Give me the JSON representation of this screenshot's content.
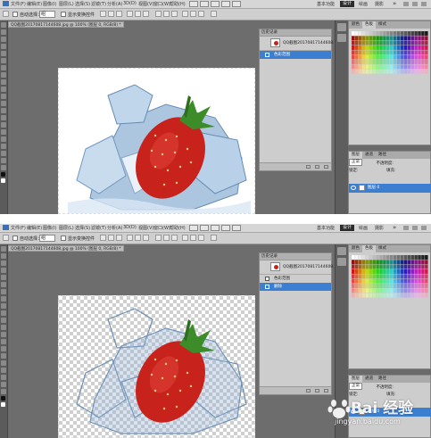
{
  "menu": {
    "items": [
      "文件(F)",
      "编辑(E)",
      "图像(I)",
      "图层(L)",
      "选择(S)",
      "滤镜(T)",
      "分析(A)",
      "3D(D)",
      "视图(V)",
      "窗口(W)",
      "帮助(H)"
    ],
    "workspaces": [
      "基本功能",
      "设计",
      "绘画",
      "摄影"
    ]
  },
  "options": {
    "auto_select": "自动选择：",
    "auto_select_target": "组",
    "transform_controls": "显示变换控件"
  },
  "document": {
    "tab1": "QQ截图20170817144608.jpg @ 100% (图层 0, RGB/8) *",
    "tab2": "QQ截图20170817144608.jpg @ 100% (图层 0, RGB/8) *"
  },
  "history": {
    "title": "历史记录",
    "snapshot": "QQ截图20170817144608...",
    "shot1_states": [
      "色彩范围"
    ],
    "shot2_states": [
      "色彩范围",
      "删除"
    ]
  },
  "panels": {
    "swatch_tabs": [
      "颜色",
      "色板",
      "样式"
    ],
    "layer_tabs": [
      "图层",
      "通道",
      "路径"
    ],
    "blend_mode": "正常",
    "opacity_label": "不透明度:",
    "lock_label": "锁定:",
    "fill_label": "填充:",
    "layer_name": "图层 0"
  },
  "watermark": {
    "brand": "Bai 经验",
    "url": "jingyan.baidu.com"
  },
  "colors": {
    "active_highlight": "#3c7fd0",
    "strawberry": "#c8221d",
    "leaf": "#3d8c2a",
    "ice": "#9fbdd9"
  }
}
